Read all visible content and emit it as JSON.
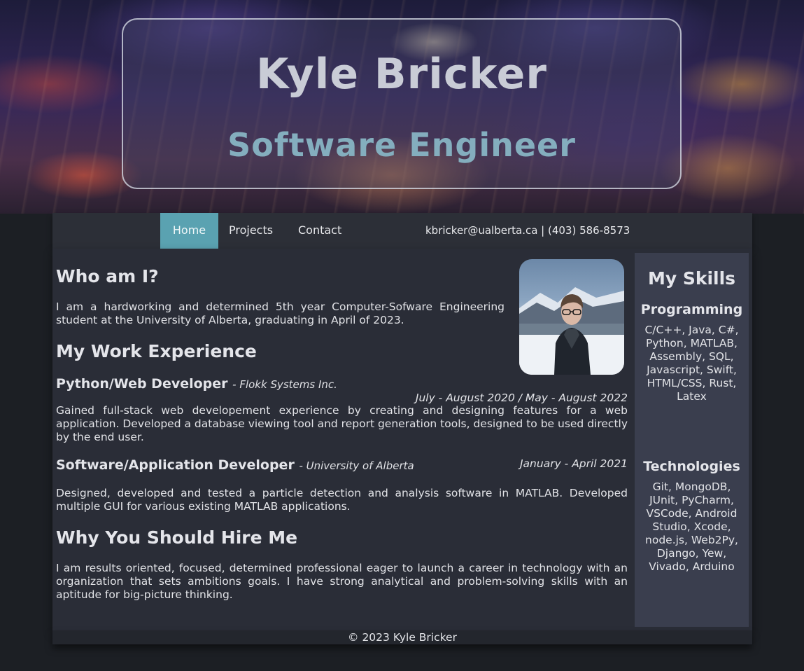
{
  "hero": {
    "name": "Kyle Bricker",
    "title": "Software Engineer"
  },
  "nav": {
    "items": [
      {
        "label": "Home",
        "active": true
      },
      {
        "label": "Projects",
        "active": false
      },
      {
        "label": "Contact",
        "active": false
      }
    ],
    "contact_info": "kbricker@ualberta.ca | (403) 586-8573",
    "active_color": "#5aa2b1"
  },
  "about": {
    "heading": "Who am I?",
    "text": "I am a hardworking and determined 5th year Computer-Sofware Engineering student at the University of Alberta, graduating in April of 2023."
  },
  "work": {
    "heading": "My Work Experience",
    "jobs": [
      {
        "title": "Python/Web Developer",
        "org": "- Flokk Systems Inc.",
        "dates": "July - August 2020 / May - August 2022",
        "description": "Gained full-stack web developement experience by creating and designing features for a web application. Developed a database viewing tool and report generation tools, designed to be used directly by the end user."
      },
      {
        "title": "Software/Application Developer",
        "org": "- University of Alberta",
        "dates": "January - April 2021",
        "description": "Designed, developed and tested a particle detection and analysis software in MATLAB. Developed multiple GUI for various existing MATLAB applications."
      }
    ]
  },
  "hire": {
    "heading": "Why You Should Hire Me",
    "text": "I am results oriented, focused, determined professional eager to launch a career in technology with an organization that sets ambitions goals. I have strong analytical and problem-solving skills with an aptitude for big-picture thinking."
  },
  "skills": {
    "heading": "My Skills",
    "programming_heading": "Programming",
    "programming": "C/C++, Java, C#, Python, MATLAB, Assembly, SQL, Javascript, Swift, HTML/CSS, Rust, Latex",
    "technologies_heading": "Technologies",
    "technologies": "Git, MongoDB, JUnit, PyCharm, VSCode, Android Studio, Xcode, node.js, Web2Py, Django, Yew, Vivado, Arduino"
  },
  "footer": {
    "text": "© 2023 Kyle Bricker"
  }
}
